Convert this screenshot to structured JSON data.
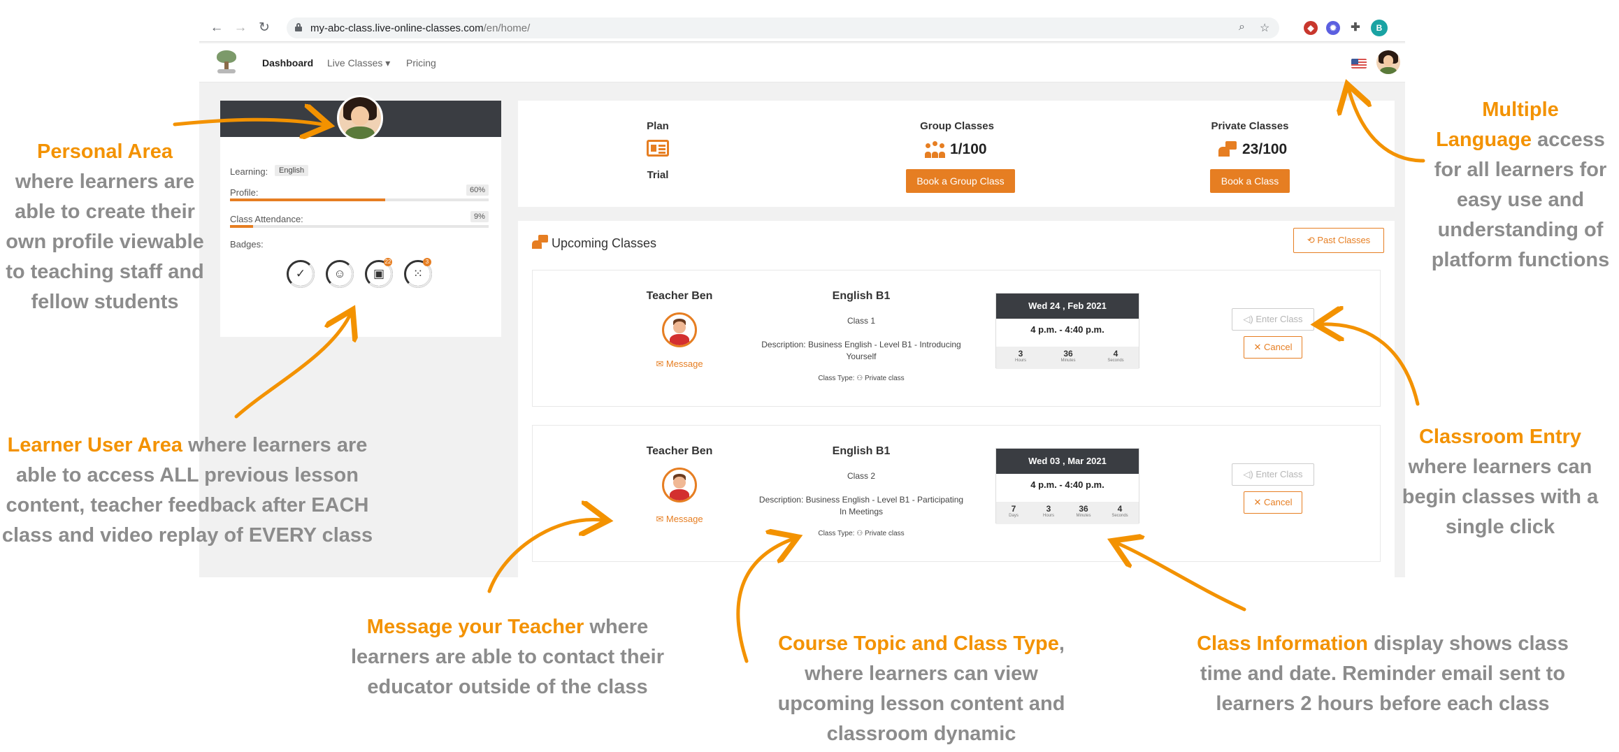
{
  "browser": {
    "url_domain": "my-abc-class.live-online-classes.com",
    "url_path": "/en/home/",
    "profile_initial": "B"
  },
  "nav": {
    "dashboard": "Dashboard",
    "live_classes": "Live Classes ▾",
    "pricing": "Pricing"
  },
  "profile": {
    "learning_label": "Learning:",
    "learning_value": "English",
    "profile_label": "Profile:",
    "profile_pct": "60%",
    "profile_progress": 0.6,
    "attendance_label": "Class Attendance:",
    "attendance_pct": "9%",
    "attendance_progress": 0.09,
    "badges_label": "Badges:",
    "badge_counts": [
      "",
      "",
      "22",
      "3"
    ]
  },
  "stats": {
    "plan_title": "Plan",
    "plan_value": "Trial",
    "group_title": "Group Classes",
    "group_value": "1/100",
    "group_button": "Book a Group Class",
    "private_title": "Private Classes",
    "private_value": "23/100",
    "private_button": "Book a Class"
  },
  "upcoming": {
    "title": "Upcoming Classes",
    "past_button": "⟲ Past Classes",
    "classes": [
      {
        "teacher": "Teacher Ben",
        "message": "✉ Message",
        "course": "English B1",
        "class_no": "Class 1",
        "description": "Description: Business English - Level B1 - Introducing Yourself",
        "class_type": "Class Type: ⚇ Private class",
        "date": "Wed 24 , Feb 2021",
        "time": "4 p.m. - 4:40 p.m.",
        "countdown": [
          {
            "n": "3",
            "u": "Hours"
          },
          {
            "n": "36",
            "u": "Minutes"
          },
          {
            "n": "4",
            "u": "Seconds"
          }
        ],
        "enter": "◁) Enter Class",
        "cancel": "✕ Cancel"
      },
      {
        "teacher": "Teacher Ben",
        "message": "✉ Message",
        "course": "English B1",
        "class_no": "Class 2",
        "description": "Description: Business English - Level B1 - Participating In Meetings",
        "class_type": "Class Type: ⚇ Private class",
        "date": "Wed 03 , Mar 2021",
        "time": "4 p.m. - 4:40 p.m.",
        "countdown": [
          {
            "n": "7",
            "u": "Days"
          },
          {
            "n": "3",
            "u": "Hours"
          },
          {
            "n": "36",
            "u": "Minutes"
          },
          {
            "n": "4",
            "u": "Seconds"
          }
        ],
        "enter": "◁) Enter Class",
        "cancel": "✕ Cancel"
      }
    ]
  },
  "annotations": {
    "personal": {
      "hl": "Personal Area",
      "rest": "where learners are able to create their own profile viewable to teaching staff and fellow students"
    },
    "learner": {
      "hl": "Learner User Area",
      "rest": "where learners are able to access ALL previous lesson content, teacher feedback after EACH class and video replay of EVERY class"
    },
    "message": {
      "hl": "Message your Teacher",
      "rest": "where learners are able to contact their educator outside of the class"
    },
    "course": {
      "hl": "Course Topic and Class Type",
      "rest": ", where learners can view upcoming lesson content and classroom dynamic"
    },
    "info": {
      "hl": "Class Information",
      "rest": "display shows class time and date. Reminder email sent to learners 2 hours before each class"
    },
    "entry": {
      "hl": "Classroom Entry",
      "rest": "where learners can begin classes with a single click"
    },
    "language_a": {
      "hl": "Multiple"
    },
    "language_b": {
      "hl": "Language",
      "rest": "access for all learners for easy use and understanding of platform functions"
    }
  },
  "colors": {
    "accent": "#e67e22",
    "annotation_orange": "#f39200",
    "annotation_gray": "#8c8c8c",
    "dark_header": "#3a3d42"
  }
}
